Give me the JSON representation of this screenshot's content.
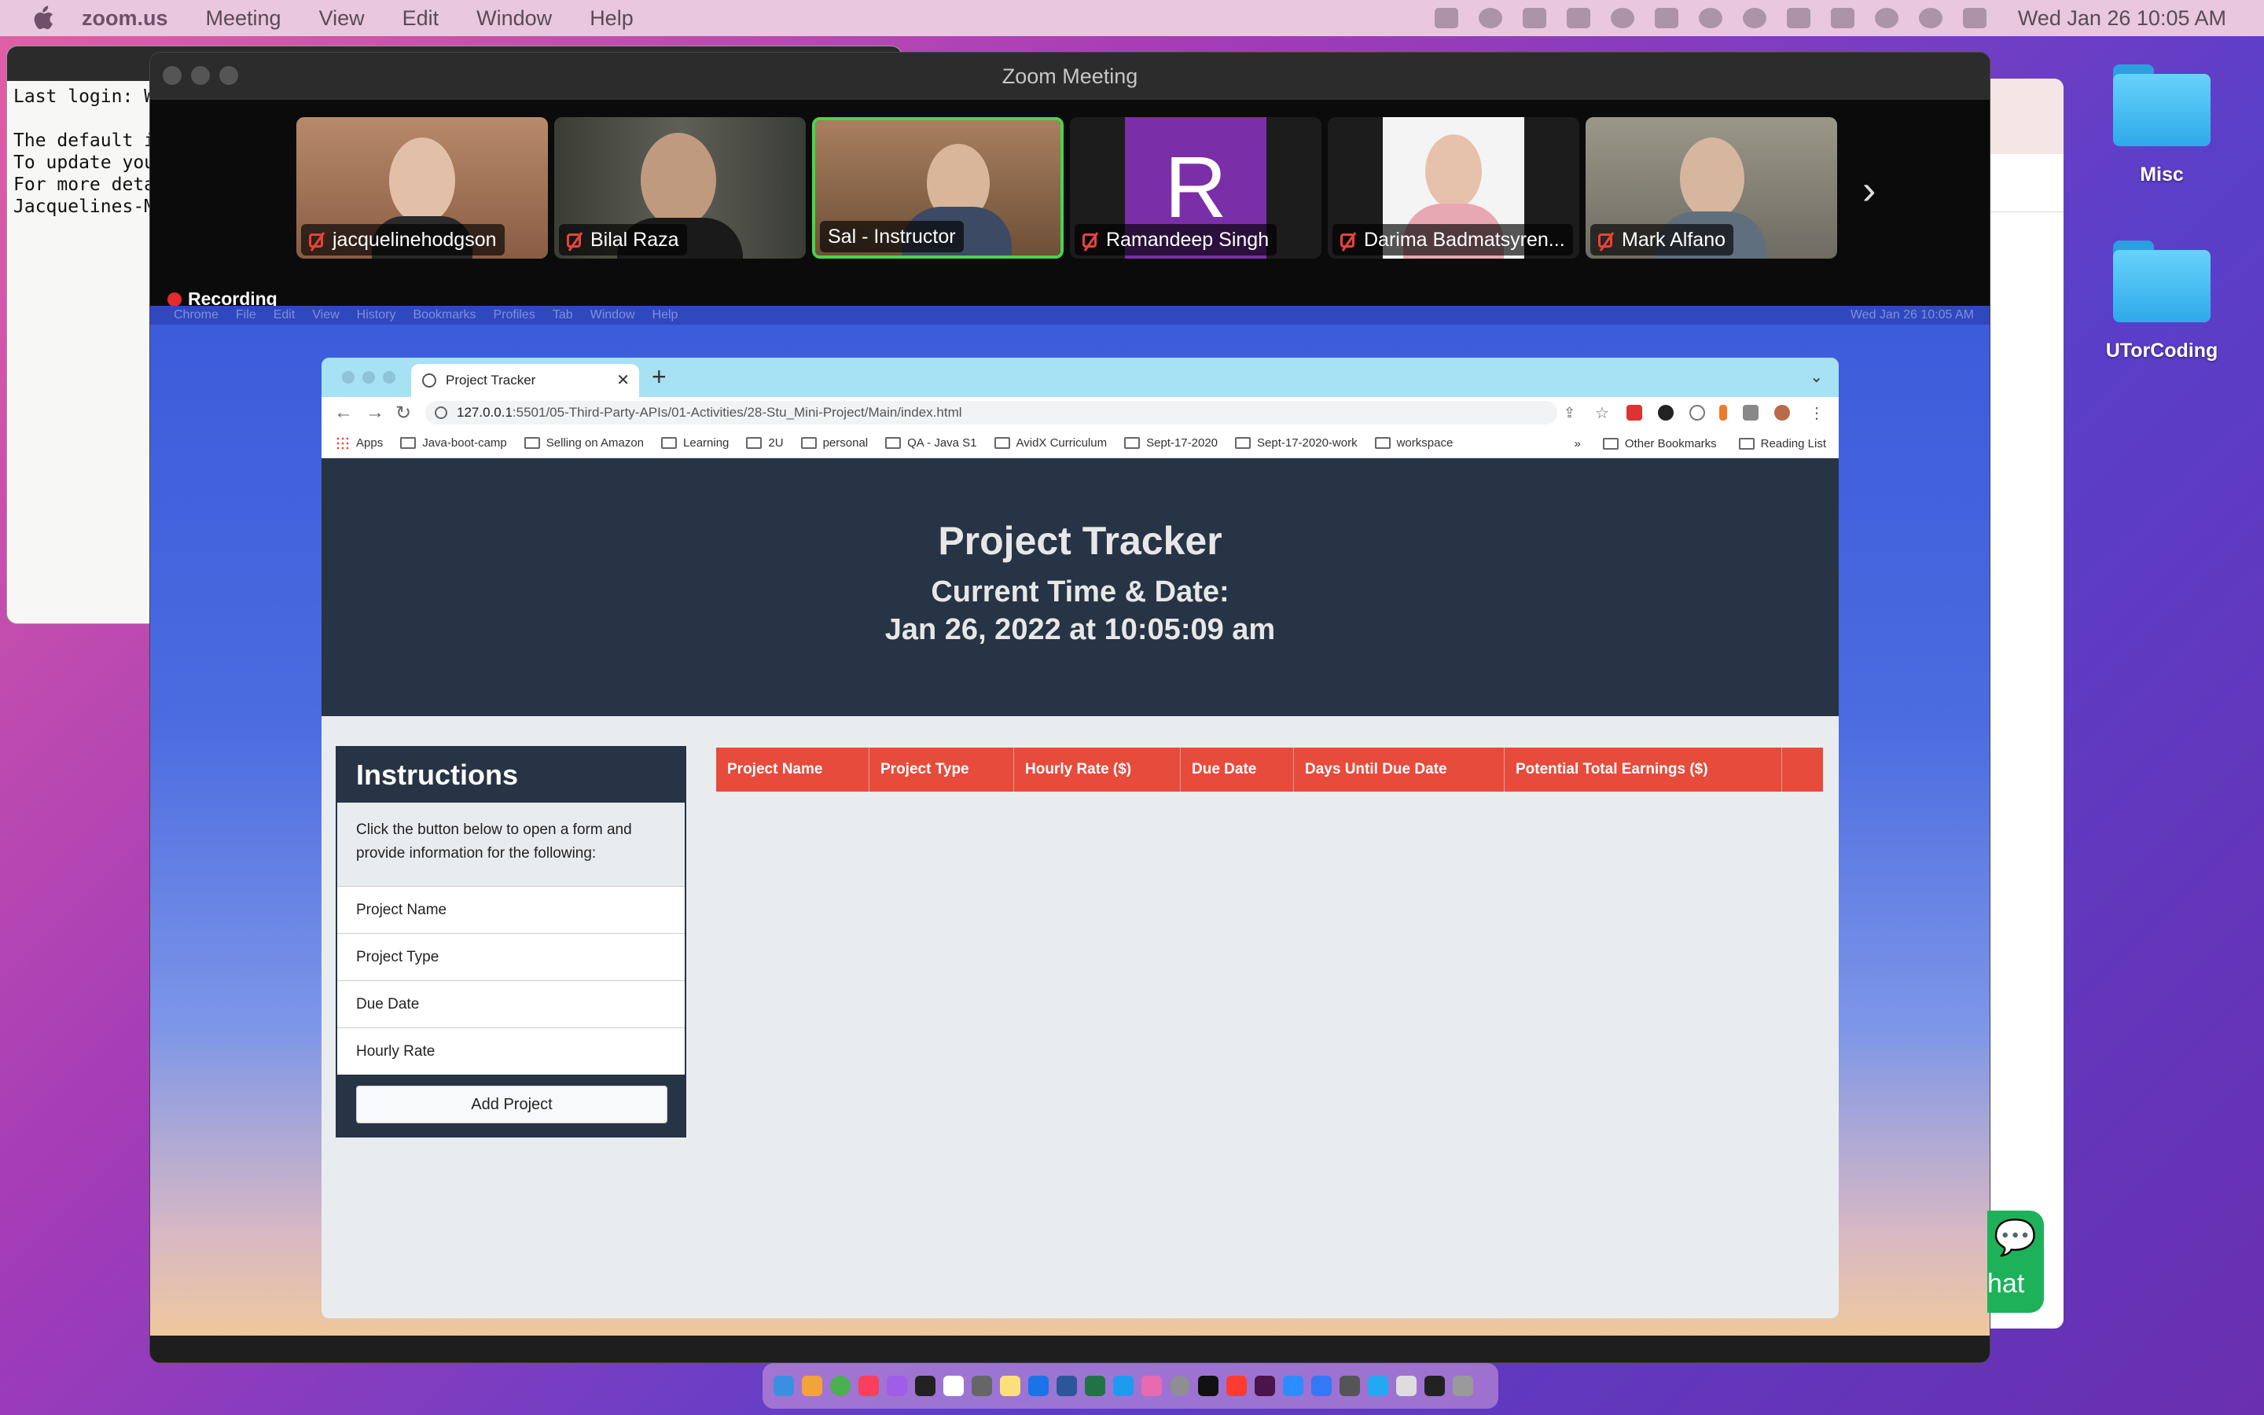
{
  "menubar": {
    "app": "zoom.us",
    "items": [
      "Meeting",
      "View",
      "Edit",
      "Window",
      "Help"
    ],
    "clock": "Wed Jan 26  10:05 AM"
  },
  "desktop": {
    "folders": [
      "Misc",
      "UTorCoding"
    ]
  },
  "terminal": {
    "lines": [
      "Last login: W",
      "",
      "The default i",
      "To update you",
      "For more deta",
      "Jacquelines-M"
    ]
  },
  "zoom": {
    "title": "Zoom Meeting",
    "recording": "Recording",
    "participants": [
      {
        "name": "jacquelinehodgson",
        "muted": true,
        "active": false,
        "bg": "#a7775a"
      },
      {
        "name": "Bilal Raza",
        "muted": true,
        "active": false,
        "bg": "#4a4b45"
      },
      {
        "name": "Sal - Instructor",
        "muted": false,
        "active": true,
        "bg": "#8e6a4b"
      },
      {
        "name": "Ramandeep Singh",
        "muted": true,
        "active": false,
        "bg": "#7a2ea8",
        "initial": "R"
      },
      {
        "name": "Darima Badmatsyren...",
        "muted": true,
        "active": false,
        "bg": "#f2f2f2"
      },
      {
        "name": "Mark Alfano",
        "muted": true,
        "active": false,
        "bg": "#8c8a80"
      }
    ]
  },
  "shared_menubar": {
    "items": [
      "Chrome",
      "File",
      "Edit",
      "View",
      "History",
      "Bookmarks",
      "Profiles",
      "Tab",
      "Window",
      "Help"
    ],
    "clock": "Wed Jan 26  10:05 AM"
  },
  "browser": {
    "tab_title": "Project Tracker",
    "url_host": "127.0.0.1",
    "url_path": ":5501/05-Third-Party-APIs/01-Activities/28-Stu_Mini-Project/Main/index.html",
    "bookmarks": [
      "Apps",
      "Java-boot-camp",
      "Selling on Amazon",
      "Learning",
      "2U",
      "personal",
      "QA - Java S1",
      "AvidX Curriculum",
      "Sept-17-2020",
      "Sept-17-2020-work",
      "workspace"
    ],
    "other_bookmarks": "Other Bookmarks",
    "reading_list": "Reading List"
  },
  "app": {
    "title": "Project Tracker",
    "time_label": "Current Time & Date:",
    "time_value": "Jan 26, 2022 at 10:05:09 am",
    "instructions": {
      "heading": "Instructions",
      "description": "Click the button below to open a form and provide information for the following:",
      "items": [
        "Project Name",
        "Project Type",
        "Due Date",
        "Hourly Rate"
      ],
      "button": "Add Project"
    },
    "table_headers": [
      "Project Name",
      "Project Type",
      "Hourly Rate ($)",
      "Due Date",
      "Days Until Due Date",
      "Potential Total Earnings ($)",
      ""
    ]
  },
  "chat": {
    "label": "hat"
  },
  "colors": {
    "header_bg": "#263445",
    "table_header": "#e64b3c",
    "active_speaker": "#45d64b"
  }
}
